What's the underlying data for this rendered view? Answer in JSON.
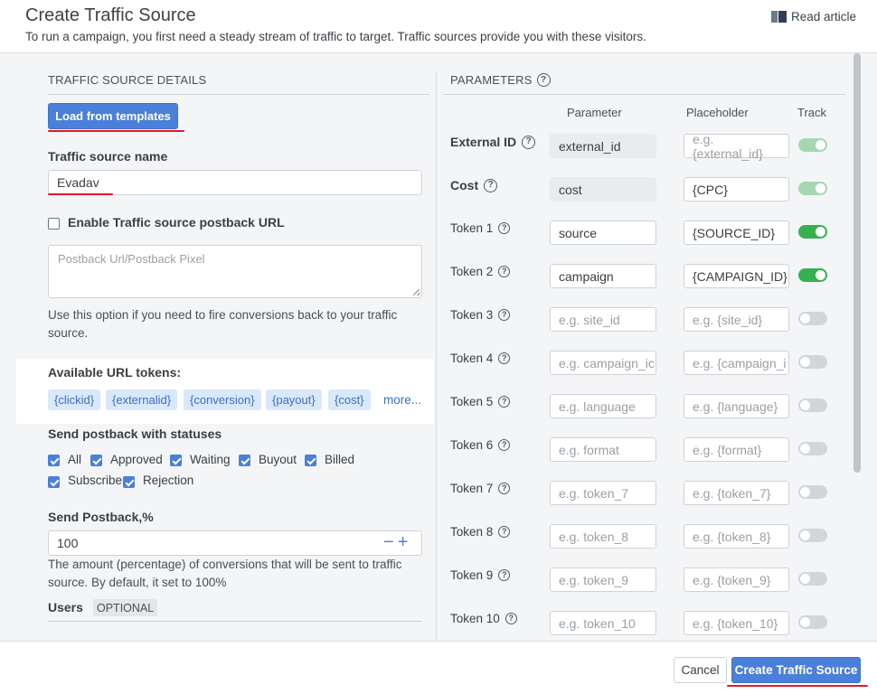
{
  "header": {
    "title": "Create Traffic Source",
    "subtitle": "To run a campaign, you first need a steady stream of traffic to target. Traffic sources provide you with these visitors.",
    "read_article": "Read article"
  },
  "details": {
    "section_title": "TRAFFIC SOURCE DETAILS",
    "load_templates": "Load from templates",
    "name_label": "Traffic source name",
    "name_value": "Evadav",
    "postback_enable_label": "Enable Traffic source postback URL",
    "postback_placeholder": "Postback Url/Postback Pixel",
    "postback_help": "Use this option if you need to fire conversions back to your traffic source.",
    "url_tokens_label": "Available URL tokens:",
    "url_tokens": [
      "{clickid}",
      "{externalid}",
      "{conversion}",
      "{payout}",
      "{cost}"
    ],
    "more": "more...",
    "statuses_label": "Send postback with statuses",
    "statuses": [
      "All",
      "Approved",
      "Waiting",
      "Buyout",
      "Billed",
      "Subscribe",
      "Rejection"
    ],
    "send_postback_label": "Send Postback,%",
    "send_postback_value": "100",
    "send_postback_help": "The amount (percentage) of conversions that will be sent to traffic source. By default, it set to 100%",
    "users_label": "Users",
    "optional": "OPTIONAL"
  },
  "parameters": {
    "section_title": "PARAMETERS",
    "col_parameter": "Parameter",
    "col_placeholder": "Placeholder",
    "col_track": "Track",
    "rows": [
      {
        "label": "External ID",
        "param": "external_id",
        "param_ph": "",
        "placeholder": "",
        "placeholder_ph": "e.g. {external_id}",
        "track": "locked-on"
      },
      {
        "label": "Cost",
        "param": "cost",
        "param_ph": "",
        "placeholder": "{CPC}",
        "placeholder_ph": "",
        "track": "locked-on"
      },
      {
        "label": "Token 1",
        "param": "source",
        "param_ph": "",
        "placeholder": "{SOURCE_ID}",
        "placeholder_ph": "",
        "track": "on"
      },
      {
        "label": "Token 2",
        "param": "campaign",
        "param_ph": "",
        "placeholder": "{CAMPAIGN_ID}",
        "placeholder_ph": "",
        "track": "on"
      },
      {
        "label": "Token 3",
        "param": "",
        "param_ph": "e.g. site_id",
        "placeholder": "",
        "placeholder_ph": "e.g. {site_id}",
        "track": "off"
      },
      {
        "label": "Token 4",
        "param": "",
        "param_ph": "e.g. campaign_ic",
        "placeholder": "",
        "placeholder_ph": "e.g. {campaign_i",
        "track": "off"
      },
      {
        "label": "Token 5",
        "param": "",
        "param_ph": "e.g. language",
        "placeholder": "",
        "placeholder_ph": "e.g. {language}",
        "track": "off"
      },
      {
        "label": "Token 6",
        "param": "",
        "param_ph": "e.g. format",
        "placeholder": "",
        "placeholder_ph": "e.g. {format}",
        "track": "off"
      },
      {
        "label": "Token 7",
        "param": "",
        "param_ph": "e.g. token_7",
        "placeholder": "",
        "placeholder_ph": "e.g. {token_7}",
        "track": "off"
      },
      {
        "label": "Token 8",
        "param": "",
        "param_ph": "e.g. token_8",
        "placeholder": "",
        "placeholder_ph": "e.g. {token_8}",
        "track": "off"
      },
      {
        "label": "Token 9",
        "param": "",
        "param_ph": "e.g. token_9",
        "placeholder": "",
        "placeholder_ph": "e.g. {token_9}",
        "track": "off"
      },
      {
        "label": "Token 10",
        "param": "",
        "param_ph": "e.g. token_10",
        "placeholder": "",
        "placeholder_ph": "e.g. {token_10}",
        "track": "off"
      }
    ]
  },
  "footer": {
    "cancel": "Cancel",
    "create": "Create Traffic Source"
  },
  "colors": {
    "primary": "#4a80d9",
    "toggle_on": "#36b04f",
    "annotation_red": "#e2182a",
    "chip_bg": "#d9e8fa"
  }
}
